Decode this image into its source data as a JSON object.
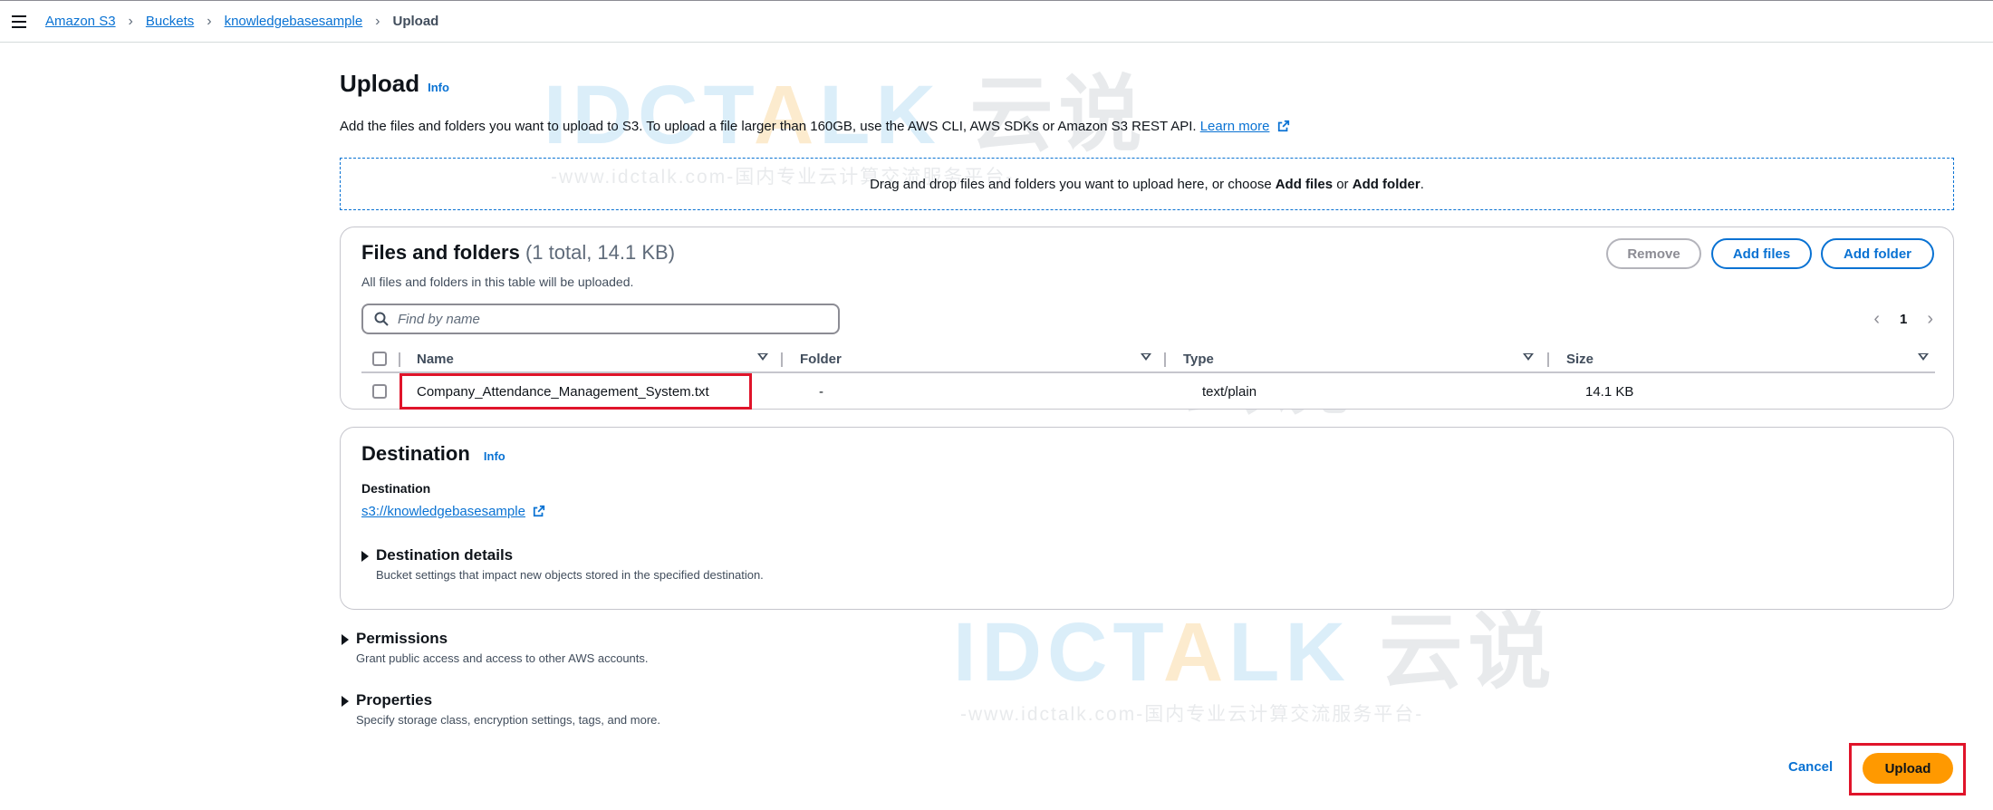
{
  "breadcrumb": {
    "items": [
      "Amazon S3",
      "Buckets",
      "knowledgebasesample"
    ],
    "current": "Upload"
  },
  "page": {
    "title": "Upload",
    "info": "Info",
    "description": "Add the files and folders you want to upload to S3. To upload a file larger than 160GB, use the AWS CLI, AWS SDKs or Amazon S3 REST API.",
    "learn_more": "Learn more"
  },
  "dropzone": {
    "prefix": "Drag and drop files and folders you want to upload here, or choose ",
    "add_files": "Add files",
    "or": " or ",
    "add_folder": "Add folder",
    "suffix": "."
  },
  "files_panel": {
    "title": "Files and folders",
    "count": "(1 total, 14.1 KB)",
    "subtitle": "All files and folders in this table will be uploaded.",
    "remove_label": "Remove",
    "add_files_label": "Add files",
    "add_folder_label": "Add folder",
    "search_placeholder": "Find by name",
    "page_number": "1",
    "columns": [
      "Name",
      "Folder",
      "Type",
      "Size"
    ],
    "rows": [
      {
        "name": "Company_Attendance_Management_System.txt",
        "folder": "-",
        "type": "text/plain",
        "size": "14.1 KB"
      }
    ]
  },
  "destination": {
    "title": "Destination",
    "info": "Info",
    "label": "Destination",
    "link": "s3://knowledgebasesample",
    "details_title": "Destination details",
    "details_desc": "Bucket settings that impact new objects stored in the specified destination."
  },
  "permissions": {
    "title": "Permissions",
    "desc": "Grant public access and access to other AWS accounts."
  },
  "properties": {
    "title": "Properties",
    "desc": "Specify storage class, encryption settings, tags, and more."
  },
  "actions": {
    "cancel": "Cancel",
    "upload": "Upload"
  },
  "watermark": {
    "logo_prefix": "IDCT",
    "logo_a": "A",
    "logo_suffix": "LK",
    "logo_cn": "云说",
    "url": "-www.idctalk.com-国内专业云计算交流服务平台-"
  },
  "colors": {
    "link": "#0972d3",
    "primary_button": "#ff9900",
    "highlight": "#e0142a"
  }
}
